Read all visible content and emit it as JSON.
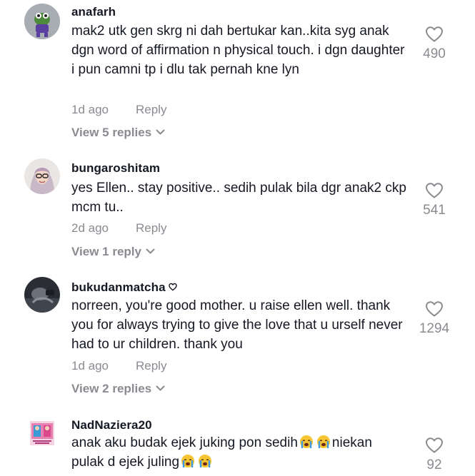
{
  "comments": [
    {
      "username": "anafarh",
      "text": "mak2 utk gen skrg ni dah bertukar kan..kita syg anak dgn word of affirmation n physical touch. i dgn daughter i pun camni tp i dlu tak pernah kne lyn",
      "time": "1d ago",
      "reply_label": "Reply",
      "view_replies": "View 5 replies",
      "likes": "490"
    },
    {
      "username": "bungaroshitam",
      "text": "yes Ellen.. stay positive.. sedih pulak bila dgr anak2 ckp mcm tu..",
      "time": "2d ago",
      "reply_label": "Reply",
      "view_replies": "View 1 reply",
      "likes": "541"
    },
    {
      "username": "bukudanmatcha",
      "text": "norreen, you're good mother. u raise ellen well. thank you for always trying to give the love that u urself never had to ur children. thank you",
      "time": "1d ago",
      "reply_label": "Reply",
      "view_replies": "View 2 replies",
      "likes": "1294"
    },
    {
      "username": "NadNaziera20",
      "text_part1": "anak aku budak ejek juking pon sedih",
      "text_part2": "niekan pulak d ejek juling",
      "likes": "92"
    }
  ],
  "icons": {
    "like": "heart-outline-icon",
    "expand": "chevron-down-icon",
    "emoji": "loudly-crying-face-emoji"
  },
  "colors": {
    "text": "#161823",
    "muted": "#8a8b91"
  }
}
